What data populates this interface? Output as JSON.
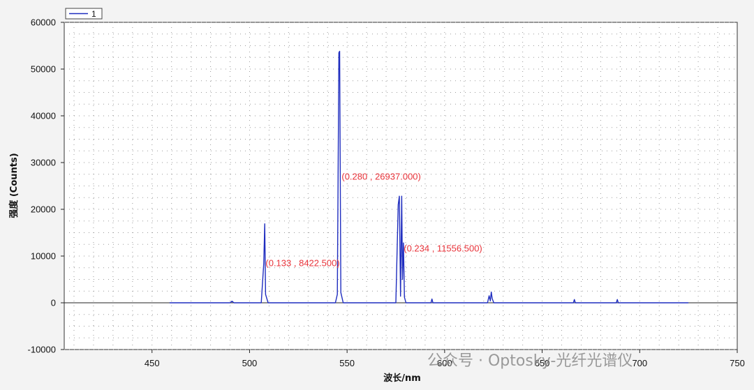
{
  "chart_data": {
    "type": "line",
    "xlabel": "波长/nm",
    "ylabel": "强度 (Counts)",
    "xlim": [
      405,
      750
    ],
    "ylim": [
      -10000,
      60000
    ],
    "xticks": [
      450,
      500,
      550,
      600,
      650,
      700,
      750
    ],
    "yticks": [
      -10000,
      0,
      10000,
      20000,
      30000,
      40000,
      50000,
      60000
    ],
    "grid": true,
    "legend_position": "top-left",
    "series": [
      {
        "name": "1",
        "color": "#1f2dbf",
        "x": [
          459,
          490,
          491,
          492,
          506,
          507.3,
          507.8,
          508.2,
          509.5,
          544,
          545,
          545.8,
          546.2,
          546.8,
          548,
          575,
          576.2,
          576.8,
          577.4,
          578,
          578.4,
          578.9,
          579.4,
          580.2,
          593,
          593.5,
          594,
          622,
          622.8,
          623.4,
          623.9,
          624.4,
          625.2,
          626.5,
          666,
          666.5,
          667,
          688,
          688.5,
          689,
          725
        ],
        "y": [
          0,
          0,
          350,
          0,
          0,
          8422.5,
          16900,
          1800,
          0,
          0,
          1800,
          53500,
          53800,
          2200,
          0,
          0,
          21000,
          22800,
          1400,
          22800,
          5000,
          12800,
          1200,
          0,
          0,
          800,
          0,
          0,
          1500,
          400,
          2300,
          900,
          0,
          0,
          0,
          700,
          0,
          0,
          700,
          0,
          0
        ]
      }
    ],
    "annotations": [
      {
        "text": "(0.133 , 8422.500)",
        "x": 507.5,
        "y": 8422.5
      },
      {
        "text": "(0.280 , 26937.000)",
        "x": 546.5,
        "y": 26937
      },
      {
        "text": "(0.234 , 11556.500)",
        "x": 578.3,
        "y": 11556.5
      }
    ]
  },
  "watermark": "公众号 · Optosky-光纤光谱仪"
}
